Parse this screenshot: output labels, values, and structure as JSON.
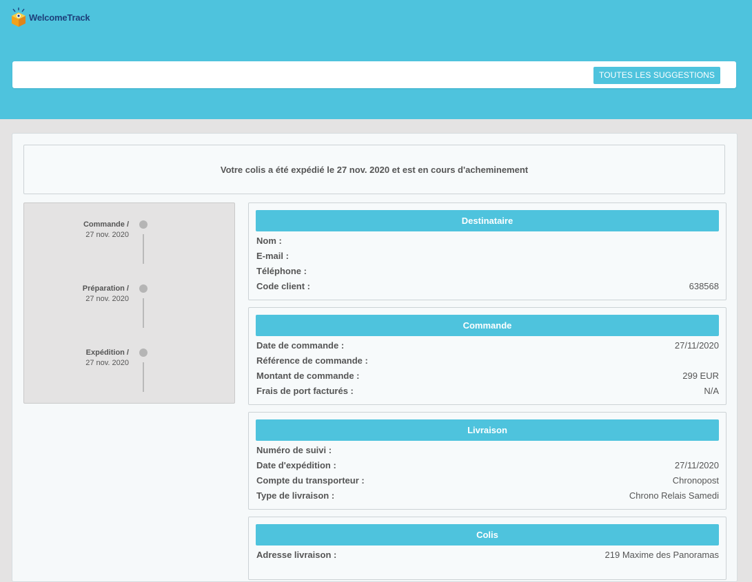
{
  "header": {
    "logo_text": "WelcomeTrack",
    "suggestions_button": "TOUTES LES SUGGESTIONS"
  },
  "status": {
    "message": "Votre colis a été expédié le 27 nov. 2020 et est en cours d'acheminement"
  },
  "timeline": [
    {
      "title": "Commande /",
      "date": "27 nov. 2020"
    },
    {
      "title": "Préparation /",
      "date": "27 nov. 2020"
    },
    {
      "title": "Expédition /",
      "date": "27 nov. 2020"
    }
  ],
  "cards": {
    "destinataire": {
      "title": "Destinataire",
      "rows": [
        {
          "label": "Nom :",
          "value": ""
        },
        {
          "label": "E-mail :",
          "value": ""
        },
        {
          "label": "Téléphone :",
          "value": ""
        },
        {
          "label": "Code client :",
          "value": "638568"
        }
      ]
    },
    "commande": {
      "title": "Commande",
      "rows": [
        {
          "label": "Date de commande :",
          "value": "27/11/2020"
        },
        {
          "label": "Référence de commande :",
          "value": ""
        },
        {
          "label": "Montant de commande :",
          "value": "299 EUR"
        },
        {
          "label": "Frais de port facturés :",
          "value": "N/A"
        }
      ]
    },
    "livraison": {
      "title": "Livraison",
      "rows": [
        {
          "label": "Numéro de suivi :",
          "value": ""
        },
        {
          "label": "Date d'expédition :",
          "value": "27/11/2020"
        },
        {
          "label": "Compte du transporteur :",
          "value": "Chronopost"
        },
        {
          "label": "Type de livraison :",
          "value": "Chrono Relais Samedi"
        }
      ]
    },
    "colis": {
      "title": "Colis",
      "rows": [
        {
          "label": "Adresse livraison :",
          "value": "219 Maxime des Panoramas"
        }
      ]
    }
  },
  "colors": {
    "accent": "#4ec3dd",
    "logo_text": "#1d3f7a",
    "background": "#e4e3e3"
  }
}
